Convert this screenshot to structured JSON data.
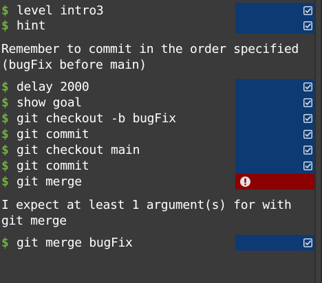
{
  "prompt_symbol": "$",
  "colors": {
    "background": "#3a3a3a",
    "prompt": "#6fb23c",
    "status_ok": "#0d3a73",
    "status_error": "#8b0000",
    "text": "#ffffff"
  },
  "commands": [
    {
      "text": "level intro3",
      "status": "ok",
      "icon": "check-icon"
    },
    {
      "text": "hint",
      "status": "ok",
      "icon": "check-icon"
    },
    {
      "text": "delay 2000",
      "status": "ok",
      "icon": "check-icon"
    },
    {
      "text": "show goal",
      "status": "ok",
      "icon": "check-icon"
    },
    {
      "text": "git checkout -b bugFix",
      "status": "ok",
      "icon": "check-icon"
    },
    {
      "text": "git commit",
      "status": "ok",
      "icon": "check-icon"
    },
    {
      "text": "git checkout main",
      "status": "ok",
      "icon": "check-icon"
    },
    {
      "text": "git commit",
      "status": "ok",
      "icon": "check-icon"
    },
    {
      "text": "git merge",
      "status": "error",
      "icon": "error-icon"
    },
    {
      "text": "git merge bugFix",
      "status": "ok",
      "icon": "check-icon"
    }
  ],
  "messages": {
    "hint_line1": "Remember to commit in the order specified",
    "hint_line2": "(bugFix before main)",
    "error_line1": "I expect at least 1 argument(s) for with",
    "error_line2": "git merge"
  }
}
